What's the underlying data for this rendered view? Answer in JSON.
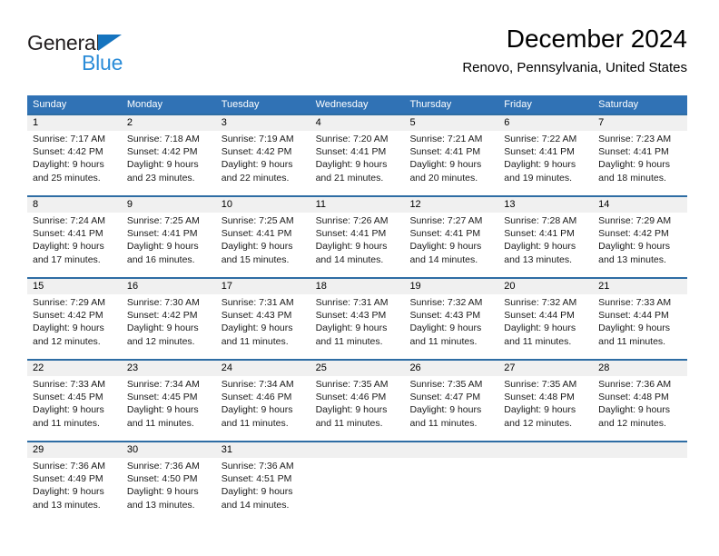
{
  "brand": {
    "name_part1": "General",
    "name_part2": "Blue",
    "triangle_icon": "triangle-icon",
    "color_dark": "#231f20",
    "color_blue": "#2b8cd8"
  },
  "header": {
    "title": "December 2024",
    "location": "Renovo, Pennsylvania, United States"
  },
  "theme": {
    "header_blue": "#3072b5",
    "row_divider_blue": "#2e6da4",
    "daynum_band": "#f0f0f0",
    "text": "#000000"
  },
  "weekday_headers": [
    "Sunday",
    "Monday",
    "Tuesday",
    "Wednesday",
    "Thursday",
    "Friday",
    "Saturday"
  ],
  "weeks": [
    [
      {
        "day": "1",
        "info": "Sunrise: 7:17 AM\nSunset: 4:42 PM\nDaylight: 9 hours\nand 25 minutes."
      },
      {
        "day": "2",
        "info": "Sunrise: 7:18 AM\nSunset: 4:42 PM\nDaylight: 9 hours\nand 23 minutes."
      },
      {
        "day": "3",
        "info": "Sunrise: 7:19 AM\nSunset: 4:42 PM\nDaylight: 9 hours\nand 22 minutes."
      },
      {
        "day": "4",
        "info": "Sunrise: 7:20 AM\nSunset: 4:41 PM\nDaylight: 9 hours\nand 21 minutes."
      },
      {
        "day": "5",
        "info": "Sunrise: 7:21 AM\nSunset: 4:41 PM\nDaylight: 9 hours\nand 20 minutes."
      },
      {
        "day": "6",
        "info": "Sunrise: 7:22 AM\nSunset: 4:41 PM\nDaylight: 9 hours\nand 19 minutes."
      },
      {
        "day": "7",
        "info": "Sunrise: 7:23 AM\nSunset: 4:41 PM\nDaylight: 9 hours\nand 18 minutes."
      }
    ],
    [
      {
        "day": "8",
        "info": "Sunrise: 7:24 AM\nSunset: 4:41 PM\nDaylight: 9 hours\nand 17 minutes."
      },
      {
        "day": "9",
        "info": "Sunrise: 7:25 AM\nSunset: 4:41 PM\nDaylight: 9 hours\nand 16 minutes."
      },
      {
        "day": "10",
        "info": "Sunrise: 7:25 AM\nSunset: 4:41 PM\nDaylight: 9 hours\nand 15 minutes."
      },
      {
        "day": "11",
        "info": "Sunrise: 7:26 AM\nSunset: 4:41 PM\nDaylight: 9 hours\nand 14 minutes."
      },
      {
        "day": "12",
        "info": "Sunrise: 7:27 AM\nSunset: 4:41 PM\nDaylight: 9 hours\nand 14 minutes."
      },
      {
        "day": "13",
        "info": "Sunrise: 7:28 AM\nSunset: 4:41 PM\nDaylight: 9 hours\nand 13 minutes."
      },
      {
        "day": "14",
        "info": "Sunrise: 7:29 AM\nSunset: 4:42 PM\nDaylight: 9 hours\nand 13 minutes."
      }
    ],
    [
      {
        "day": "15",
        "info": "Sunrise: 7:29 AM\nSunset: 4:42 PM\nDaylight: 9 hours\nand 12 minutes."
      },
      {
        "day": "16",
        "info": "Sunrise: 7:30 AM\nSunset: 4:42 PM\nDaylight: 9 hours\nand 12 minutes."
      },
      {
        "day": "17",
        "info": "Sunrise: 7:31 AM\nSunset: 4:43 PM\nDaylight: 9 hours\nand 11 minutes."
      },
      {
        "day": "18",
        "info": "Sunrise: 7:31 AM\nSunset: 4:43 PM\nDaylight: 9 hours\nand 11 minutes."
      },
      {
        "day": "19",
        "info": "Sunrise: 7:32 AM\nSunset: 4:43 PM\nDaylight: 9 hours\nand 11 minutes."
      },
      {
        "day": "20",
        "info": "Sunrise: 7:32 AM\nSunset: 4:44 PM\nDaylight: 9 hours\nand 11 minutes."
      },
      {
        "day": "21",
        "info": "Sunrise: 7:33 AM\nSunset: 4:44 PM\nDaylight: 9 hours\nand 11 minutes."
      }
    ],
    [
      {
        "day": "22",
        "info": "Sunrise: 7:33 AM\nSunset: 4:45 PM\nDaylight: 9 hours\nand 11 minutes."
      },
      {
        "day": "23",
        "info": "Sunrise: 7:34 AM\nSunset: 4:45 PM\nDaylight: 9 hours\nand 11 minutes."
      },
      {
        "day": "24",
        "info": "Sunrise: 7:34 AM\nSunset: 4:46 PM\nDaylight: 9 hours\nand 11 minutes."
      },
      {
        "day": "25",
        "info": "Sunrise: 7:35 AM\nSunset: 4:46 PM\nDaylight: 9 hours\nand 11 minutes."
      },
      {
        "day": "26",
        "info": "Sunrise: 7:35 AM\nSunset: 4:47 PM\nDaylight: 9 hours\nand 11 minutes."
      },
      {
        "day": "27",
        "info": "Sunrise: 7:35 AM\nSunset: 4:48 PM\nDaylight: 9 hours\nand 12 minutes."
      },
      {
        "day": "28",
        "info": "Sunrise: 7:36 AM\nSunset: 4:48 PM\nDaylight: 9 hours\nand 12 minutes."
      }
    ],
    [
      {
        "day": "29",
        "info": "Sunrise: 7:36 AM\nSunset: 4:49 PM\nDaylight: 9 hours\nand 13 minutes."
      },
      {
        "day": "30",
        "info": "Sunrise: 7:36 AM\nSunset: 4:50 PM\nDaylight: 9 hours\nand 13 minutes."
      },
      {
        "day": "31",
        "info": "Sunrise: 7:36 AM\nSunset: 4:51 PM\nDaylight: 9 hours\nand 14 minutes."
      },
      {
        "day": "",
        "info": ""
      },
      {
        "day": "",
        "info": ""
      },
      {
        "day": "",
        "info": ""
      },
      {
        "day": "",
        "info": ""
      }
    ]
  ]
}
